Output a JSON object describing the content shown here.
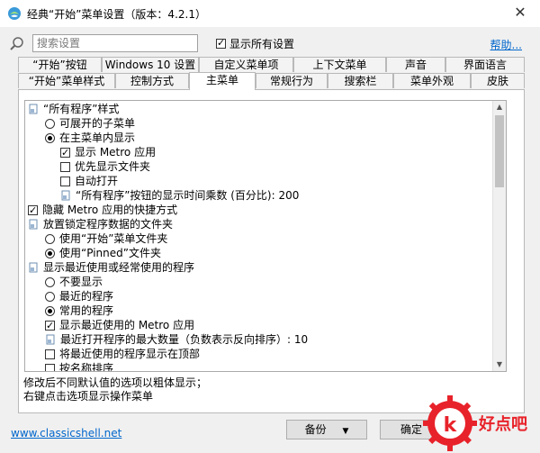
{
  "window": {
    "title": "经典“开始”菜单设置（版本：4.2.1）"
  },
  "search": {
    "placeholder": "搜索设置"
  },
  "show_all_label": "显示所有设置",
  "help_label": "帮助...",
  "tabs_row1": [
    "“开始”按钮",
    "Windows 10 设置",
    "自定义菜单项",
    "上下文菜单",
    "声音",
    "界面语言"
  ],
  "tabs_row2": [
    "“开始”菜单样式",
    "控制方式",
    "主菜单",
    "常规行为",
    "搜索栏",
    "菜单外观",
    "皮肤"
  ],
  "tree": [
    "“所有程序”样式",
    "可展开的子菜单",
    "在主菜单内显示",
    "显示 Metro 应用",
    "优先显示文件夹",
    "自动打开",
    "“所有程序”按钮的显示时间乘数 (百分比): 200",
    "隐藏 Metro 应用的快捷方式",
    "放置锁定程序数据的文件夹",
    "使用“开始”菜单文件夹",
    "使用“Pinned”文件夹",
    "显示最近使用或经常使用的程序",
    "不要显示",
    "最近的程序",
    "常用的程序",
    "显示最近使用的 Metro 应用",
    "最近打开程序的最大数量（负数表示反向排序）: 10",
    "将最近使用的程序显示在顶部",
    "按名称排序"
  ],
  "status_lines": [
    "修改后不同默认值的选项以粗体显示；",
    "右键点击选项显示操作菜单"
  ],
  "footer": {
    "link": "www.classicshell.net",
    "backup_label": "备份",
    "ok_label": "确定"
  },
  "watermark": {
    "text": "好点吧"
  },
  "colors": {
    "link": "#0066cc",
    "watermark_red": "#e8222a"
  }
}
